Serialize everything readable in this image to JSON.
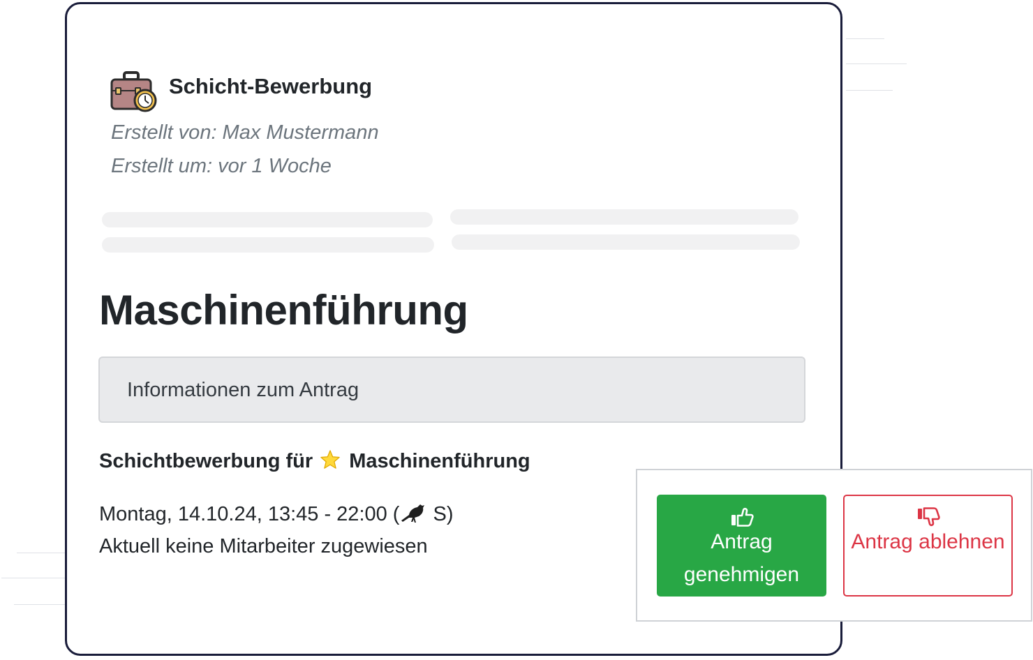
{
  "card": {
    "title": "Schicht-Bewerbung",
    "created_by": "Erstellt von: Max Mustermann",
    "created_at": "Erstellt um: vor 1 Woche",
    "header_icon": "briefcase-clock-icon"
  },
  "main": {
    "title": "Maschinenführung",
    "info_box_label": "Informationen zum Antrag",
    "application_prefix": "Schichtbewerbung für",
    "application_icon": "star-icon",
    "application_position": "Maschinenführung",
    "shift_time_text": "Montag, 14.10.24, 13:45 - 22:00 (",
    "shift_icon": "crow-icon",
    "shift_time_suffix": " S)",
    "assignment_status": "Aktuell keine Mitarbeiter zugewiesen"
  },
  "actions": {
    "approve_label": "Antrag genehmigen",
    "approve_icon": "thumbs-up-icon",
    "reject_label": "Antrag ablehnen",
    "reject_icon": "thumbs-down-icon"
  },
  "colors": {
    "card_border": "#191c3a",
    "approve": "#28a745",
    "reject": "#dc3545",
    "muted_text": "#6c757d",
    "info_box_bg": "#e9eaec"
  }
}
